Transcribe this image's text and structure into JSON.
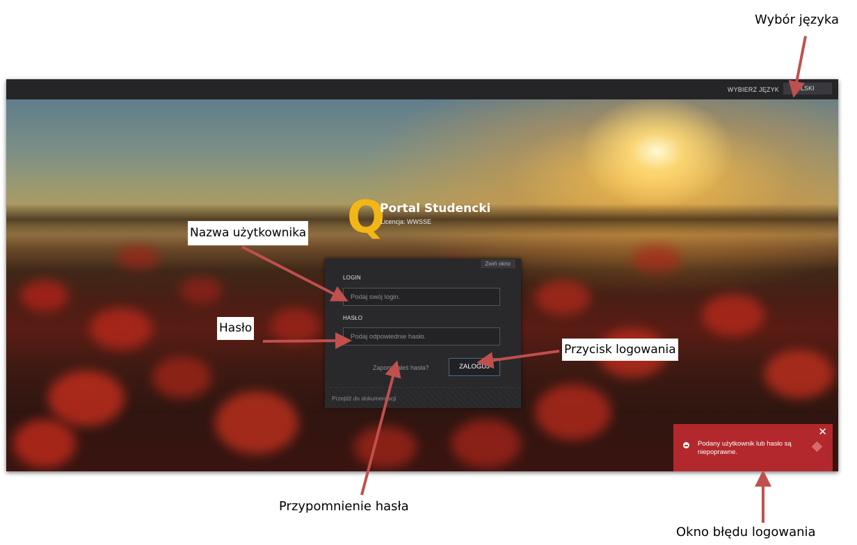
{
  "topbar": {
    "language_label": "WYBIERZ JĘZYK",
    "language_value": "POLSKI"
  },
  "brand": {
    "logo_letter": "Q",
    "title": "Portal Studencki",
    "license": "Licencja: WWSSE"
  },
  "login_form": {
    "collapse_label": "Zwiń okno",
    "login_label": "LOGIN",
    "login_placeholder": "Podaj swój login.",
    "password_label": "HASŁO",
    "password_placeholder": "Podaj odpowiednie hasło.",
    "forgot_label": "Zapomniałeś hasła?",
    "submit_label": "ZALOGUJ",
    "docs_link": "Przejdź do dokumentacji"
  },
  "error_toast": {
    "close_symbol": "✕",
    "message": "Podany użytkownik lub hasło są niepoprawne."
  },
  "annotations": {
    "language_choice": "Wybór języka",
    "username": "Nazwa użytkownika",
    "password": "Hasło",
    "login_button": "Przycisk logowania",
    "password_reminder": "Przypomnienie hasła",
    "login_error": "Okno błędu logowania"
  },
  "colors": {
    "accent_logo": "#f2b617",
    "error_background": "#b3282c",
    "annotation_arrow": "#c0504d"
  }
}
